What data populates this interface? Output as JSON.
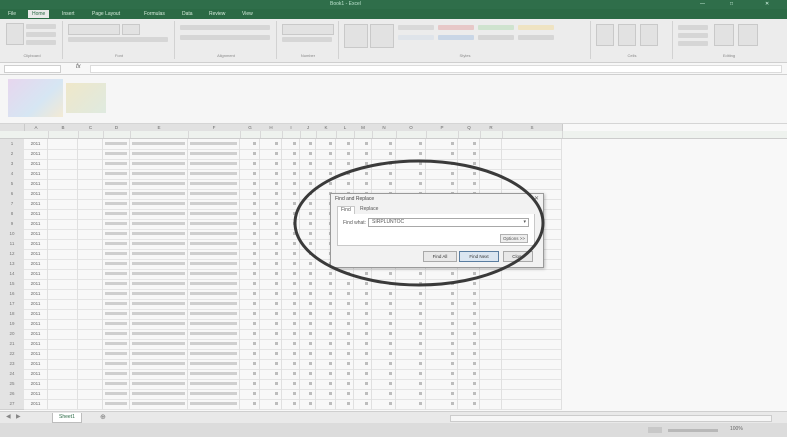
{
  "window": {
    "title": "Book1 - Excel",
    "min_glyph": "—",
    "max_glyph": "□",
    "close_glyph": "✕"
  },
  "ribbon": {
    "tabs": [
      "File",
      "Home",
      "Insert",
      "Page Layout",
      "Formulas",
      "Data",
      "Review",
      "View"
    ],
    "active_tab": "Home",
    "groups": [
      "Clipboard",
      "Font",
      "Alignment",
      "Number",
      "Styles",
      "Cells",
      "Editing"
    ]
  },
  "formula": {
    "fx": "fx",
    "content": ""
  },
  "sheet": {
    "columns": [
      "A",
      "B",
      "C",
      "D",
      "E",
      "F",
      "G",
      "H",
      "I",
      "J",
      "K",
      "L",
      "M",
      "N",
      "O",
      "P",
      "Q",
      "R",
      "S"
    ],
    "year_value": "2011",
    "row_numbers": [
      "1",
      "2",
      "3",
      "4",
      "5",
      "6",
      "7",
      "8",
      "9",
      "10",
      "11",
      "12",
      "13",
      "14",
      "15",
      "16",
      "17",
      "18",
      "19",
      "20",
      "21",
      "22",
      "23",
      "24",
      "25",
      "26",
      "27"
    ],
    "tab_name": "Sheet1"
  },
  "find_dialog": {
    "title": "Find and Replace",
    "close_glyph": "✕",
    "tabs": [
      "Find",
      "Replace"
    ],
    "find_label": "Find what:",
    "find_value": "SIRPLUNTOC",
    "options_button": "Options >>",
    "buttons": [
      "Find All",
      "Find Next",
      "Close"
    ]
  },
  "status": {
    "zoom": "100%"
  },
  "colors": {
    "excel_green": "#2b6a45",
    "highlight_circle": "#3a3a3a"
  }
}
